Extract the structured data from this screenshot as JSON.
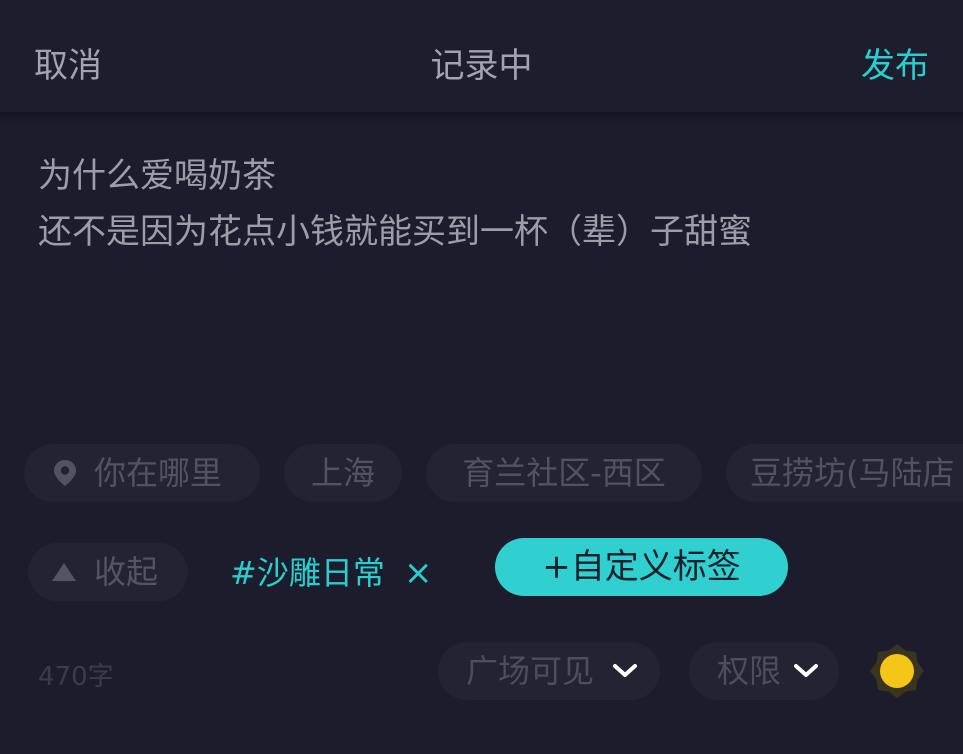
{
  "header": {
    "cancel_label": "取消",
    "title": "记录中",
    "publish_label": "发布"
  },
  "content": {
    "line1": "为什么爱喝奶茶",
    "line2": "还不是因为花点小钱就能买到一杯（辈）子甜蜜"
  },
  "location": {
    "prompt_label": "你在哪里",
    "suggestions": [
      "上海",
      "育兰社区-西区",
      "豆捞坊(马陆店"
    ]
  },
  "tags": {
    "collapse_label": "收起",
    "selected_tag": "#沙雕日常",
    "remove_symbol": "×",
    "custom_tag_label": "+自定义标签"
  },
  "footer": {
    "word_count": "470字",
    "visibility_label": "广场可见",
    "permission_label": "权限"
  },
  "icons": {
    "location": "location-pin-icon",
    "collapse": "triangle-up-icon",
    "dropdown": "chevron-down-icon",
    "theme": "sun-icon"
  },
  "colors": {
    "background": "#1c1c2c",
    "accent": "#27cfd0",
    "chip_background": "#232334",
    "sun": "#f5c518"
  }
}
